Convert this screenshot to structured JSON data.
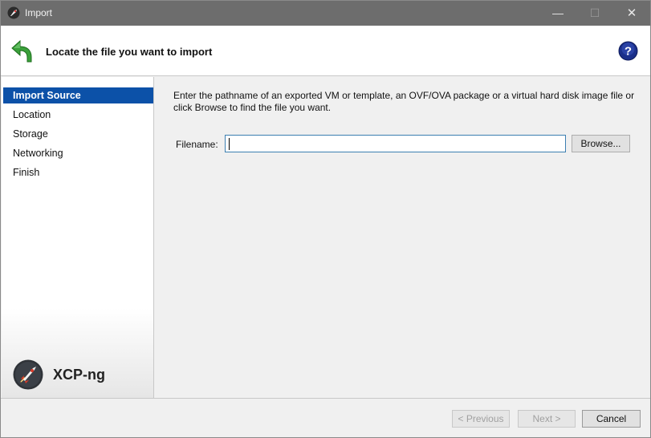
{
  "window": {
    "title": "Import",
    "controls": {
      "minimize": "—",
      "maximize": "☐",
      "close": "✕"
    }
  },
  "header": {
    "title": "Locate the file you want to import",
    "icons": {
      "back": "back-arrow-icon",
      "help": "help-icon"
    },
    "colors": {
      "back_arrow": "#3aa03a",
      "help": "#1a2f8a"
    }
  },
  "sidebar": {
    "steps": [
      {
        "label": "Import Source",
        "active": true
      },
      {
        "label": "Location",
        "active": false
      },
      {
        "label": "Storage",
        "active": false
      },
      {
        "label": "Networking",
        "active": false
      },
      {
        "label": "Finish",
        "active": false
      }
    ],
    "brand": {
      "name": "XCP-ng",
      "icon": "xcp-ng-rocket-logo"
    },
    "active_color": "#0c51a8"
  },
  "main": {
    "instructions": "Enter the pathname of an exported VM or template, an OVF/OVA package or a virtual hard disk image file or click Browse to find the file you want.",
    "filename_label": "Filename:",
    "filename_value": "",
    "browse_label": "Browse..."
  },
  "footer": {
    "previous_label": "< Previous",
    "next_label": "Next >",
    "cancel_label": "Cancel",
    "previous_enabled": false,
    "next_enabled": false
  }
}
